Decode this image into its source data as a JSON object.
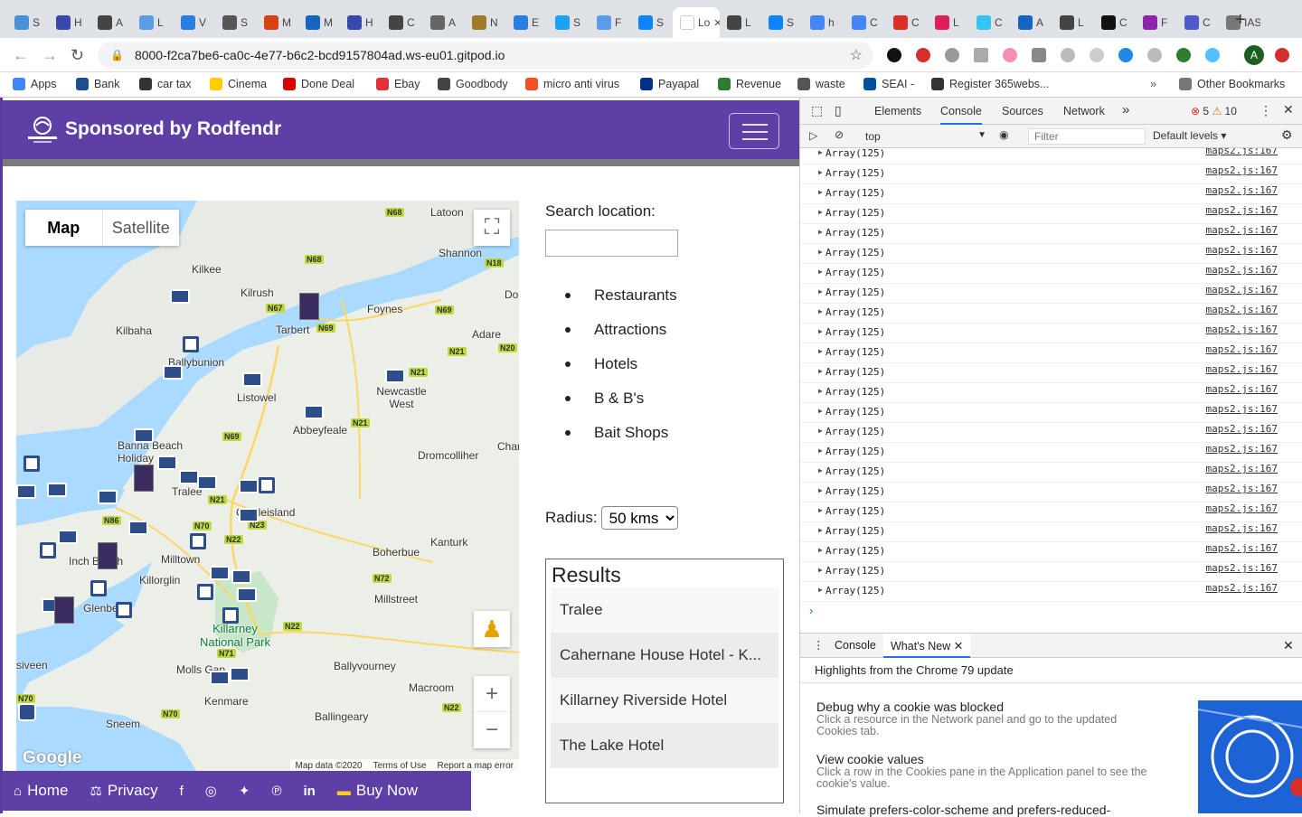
{
  "browser": {
    "tabs": [
      {
        "label": "S",
        "color": "#4a90d9"
      },
      {
        "label": "H",
        "color": "#3949ab"
      },
      {
        "label": "A",
        "color": "#444"
      },
      {
        "label": "L",
        "color": "#5c9ce6"
      },
      {
        "label": "V",
        "color": "#2a7de1"
      },
      {
        "label": "S",
        "color": "#555"
      },
      {
        "label": "M",
        "color": "#d84315"
      },
      {
        "label": "M",
        "color": "#1565c0"
      },
      {
        "label": "H",
        "color": "#3949ab"
      },
      {
        "label": "C",
        "color": "#444"
      },
      {
        "label": "A",
        "color": "#666"
      },
      {
        "label": "N",
        "color": "#9e7b2b"
      },
      {
        "label": "E",
        "color": "#2a7de1"
      },
      {
        "label": "S",
        "color": "#1da1f2"
      },
      {
        "label": "F",
        "color": "#5c9ce6"
      },
      {
        "label": "S",
        "color": "#0a84ff"
      },
      {
        "label": "Lo",
        "color": "#fff",
        "active": true
      },
      {
        "label": "L",
        "color": "#444"
      },
      {
        "label": "S",
        "color": "#0a84ff"
      },
      {
        "label": "h",
        "color": "#4285f4"
      },
      {
        "label": "C",
        "color": "#4285f4"
      },
      {
        "label": "C",
        "color": "#d93025"
      },
      {
        "label": "L",
        "color": "#e01e5a"
      },
      {
        "label": "C",
        "color": "#36c5f0"
      },
      {
        "label": "A",
        "color": "#1565c0"
      },
      {
        "label": "L",
        "color": "#444"
      },
      {
        "label": "C",
        "color": "#111"
      },
      {
        "label": "F",
        "color": "#8e24aa"
      },
      {
        "label": "C",
        "color": "#5059c9"
      },
      {
        "label": "IAS",
        "color": "#777"
      }
    ],
    "url": "8000-f2ca7be6-ca0c-4e77-b6c2-bcd9157804ad.ws-eu01.gitpod.io",
    "avatar_letter": "A",
    "bookmarks": [
      "Apps",
      "Bank",
      "car tax",
      "Cinema",
      "Done Deal",
      "Ebay",
      "Goodbody",
      "micro anti virus",
      "Payapal",
      "Revenue",
      "waste",
      "SEAI -",
      "Register 365webs..."
    ],
    "other_bookmarks": "Other Bookmarks"
  },
  "site": {
    "brand": "Sponsored by Rodfendr",
    "search_label": "Search location:",
    "search_value": "",
    "categories": [
      "Restaurants",
      "Attractions",
      "Hotels",
      "B & B's",
      "Bait Shops"
    ],
    "radius_label": "Radius:",
    "radius_value": "50 kms",
    "results_title": "Results",
    "results": [
      "Tralee",
      "Cahernane House Hotel - K...",
      "Killarney Riverside Hotel",
      "The Lake Hotel"
    ],
    "footer": {
      "home": "Home",
      "privacy": "Privacy",
      "buy": "Buy Now"
    }
  },
  "map": {
    "type_map": "Map",
    "type_satellite": "Satellite",
    "places": [
      "Latoon",
      "Shannon",
      "Kilkee",
      "Kilrush",
      "Foynes",
      "Kilbaha",
      "Tarbert",
      "Adare",
      "Ballybunion",
      "Listowel",
      "Newcastle West",
      "Abbeyfeale",
      "Dromcolliher",
      "Banna Beach Holiday",
      "Tralee",
      "Castleisland",
      "Char",
      "Kanturk",
      "Inch Beach",
      "Milltown",
      "Boherbue",
      "Killorglin",
      "Millstreet",
      "Glenbeigh",
      "Killarney National Park",
      "Ballyvourney",
      "Molls Gap",
      "Macroom",
      "Kenmare",
      "Ballingeary",
      "Sneem",
      "siveen",
      "Doo"
    ],
    "roads": [
      "N68",
      "N68",
      "N18",
      "N67",
      "N69",
      "N69",
      "N21",
      "N20",
      "N21",
      "N21",
      "N69",
      "N21",
      "N86",
      "N70",
      "N22",
      "N23",
      "N72",
      "N22",
      "N71",
      "N70",
      "N22",
      "N70"
    ],
    "footer_data": "Map data ©2020",
    "footer_terms": "Terms of Use",
    "footer_report": "Report a map error",
    "google": "Google"
  },
  "devtools": {
    "tabs": [
      "Elements",
      "Console",
      "Sources",
      "Network"
    ],
    "errors": "5",
    "warnings": "10",
    "context": "top",
    "filter_placeholder": "Filter",
    "levels": "Default levels",
    "log_text": "Array(125)",
    "log_source": "maps2.js:167",
    "log_count": 23,
    "drawer_tabs": [
      "Console",
      "What's New"
    ],
    "whatsnew_title": "Highlights from the Chrome 79 update",
    "whatsnew_items": [
      {
        "title": "Debug why a cookie was blocked",
        "desc": "Click a resource in the Network panel and go to the updated Cookies tab."
      },
      {
        "title": "View cookie values",
        "desc": "Click a row in the Cookies pane in the Application panel to see the cookie's value."
      },
      {
        "title": "Simulate prefers-color-scheme and prefers-reduced-",
        "desc": ""
      }
    ]
  }
}
